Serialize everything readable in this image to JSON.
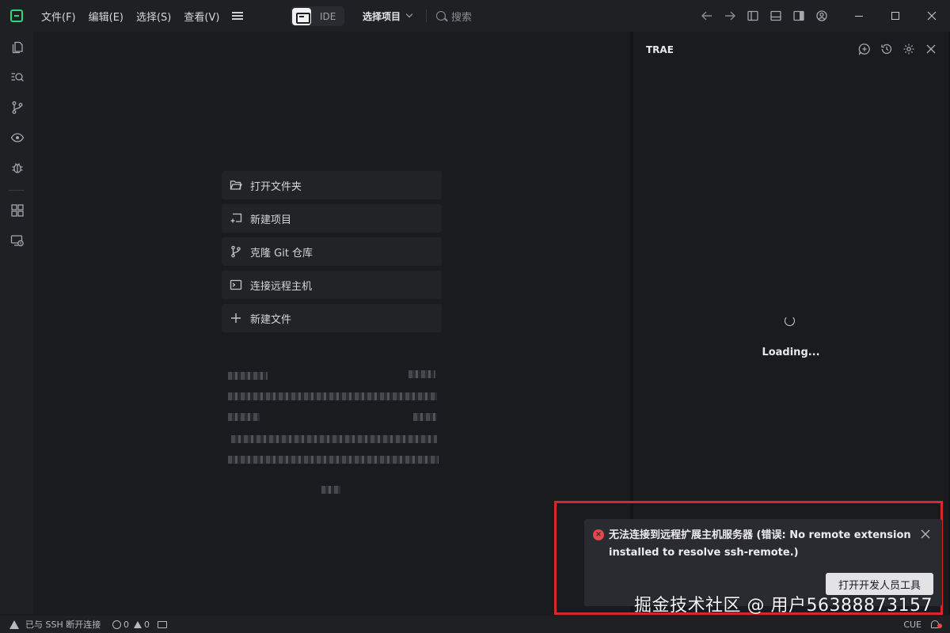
{
  "menu": {
    "file": "文件(F)",
    "edit": "编辑(E)",
    "select": "选择(S)",
    "view": "查看(V)"
  },
  "mode": {
    "ide_label": "IDE"
  },
  "project": {
    "label": "选择项目"
  },
  "search": {
    "placeholder": "搜索"
  },
  "start": {
    "items": [
      {
        "label": "打开文件夹",
        "icon": "folder-open-icon"
      },
      {
        "label": "新建项目",
        "icon": "new-project-icon"
      },
      {
        "label": "克隆 Git 仓库",
        "icon": "git-branch-icon"
      },
      {
        "label": "连接远程主机",
        "icon": "terminal-icon"
      },
      {
        "label": "新建文件",
        "icon": "plus-icon"
      }
    ]
  },
  "panel": {
    "title": "TRAE",
    "loading": "Loading..."
  },
  "status": {
    "remote": "已与 SSH 断开连接",
    "errors": "0",
    "warnings": "0",
    "cue": "CUE"
  },
  "notification": {
    "message": "无法连接到远程扩展主机服务器 (错误: No remote extension installed to resolve ssh-remote.)",
    "button": "打开开发人员工具"
  },
  "watermark": "掘金技术社区 @ 用户56388873157",
  "colors": {
    "accent": "#2fd67b",
    "error": "#e5484d",
    "highlight": "#d7282f"
  }
}
